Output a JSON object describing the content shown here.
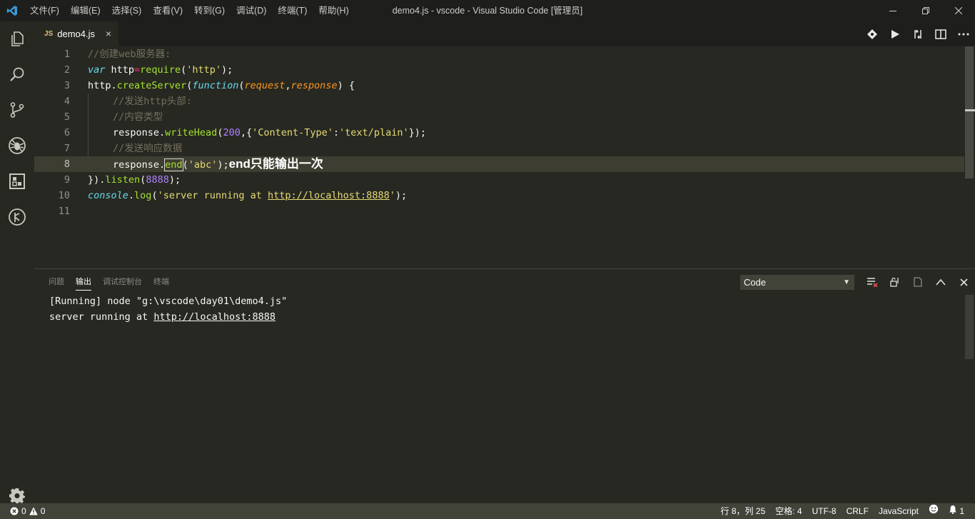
{
  "titlebar": {
    "logo_icon": "vscode-logo-icon",
    "menu": [
      "文件(F)",
      "编辑(E)",
      "选择(S)",
      "查看(V)",
      "转到(G)",
      "调试(D)",
      "终端(T)",
      "帮助(H)"
    ],
    "window_title": "demo4.js - vscode - Visual Studio Code [管理员]",
    "controls": [
      "minimize-icon",
      "restore-icon",
      "close-icon"
    ]
  },
  "activitybar": {
    "icons": [
      "explorer-icon",
      "search-icon",
      "source-control-icon",
      "debug-icon",
      "extensions-icon",
      "remote-icon"
    ],
    "bottom_icon": "settings-gear-icon"
  },
  "tabs": [
    {
      "badge": "JS",
      "label": "demo4.js",
      "close": "×"
    }
  ],
  "editor_actions": [
    "git-lens-icon",
    "run-icon",
    "compare-icon",
    "split-editor-icon",
    "more-icon"
  ],
  "editor": {
    "line_numbers": [
      "1",
      "2",
      "3",
      "4",
      "5",
      "6",
      "7",
      "8",
      "9",
      "10",
      "11"
    ],
    "current_line": 8,
    "code": {
      "l1_comment": "//创建web服务器:",
      "l2_var": "var",
      "l2_name": " http",
      "l2_eq": "=",
      "l2_require": "require",
      "l2_open": "(",
      "l2_str": "'http'",
      "l2_close": ");",
      "l3_obj": "http.",
      "l3_method": "createServer",
      "l3_open": "(",
      "l3_function": "function",
      "l3_paren": "(",
      "l3_p1": "request",
      "l3_comma": ",",
      "l3_p2": "response",
      "l3_end": ") {",
      "l4_comment": "//发送http头部:",
      "l5_comment": "//内容类型",
      "l6_obj": "response.",
      "l6_method": "writeHead",
      "l6_open": "(",
      "l6_num": "200",
      "l6_mid": ",{",
      "l6_key": "'Content-Type'",
      "l6_colon": ":",
      "l6_val": "'text/plain'",
      "l6_close": "});",
      "l7_comment": "//发送响应数据",
      "l8_obj": "response",
      "l8_dot": ".",
      "l8_method": "end",
      "l8_open": "(",
      "l8_str": "'abc'",
      "l8_close": ");",
      "l8_annotation": "end只能输出一次",
      "l9_start": "}).",
      "l9_method": "listen",
      "l9_open": "(",
      "l9_num": "8888",
      "l9_close": ");",
      "l10_obj": "console",
      "l10_dot": ".",
      "l10_method": "log",
      "l10_open": "(",
      "l10_str_a": "'server running at ",
      "l10_link": "http://localhost:8888",
      "l10_str_b": "'",
      "l10_close": ");"
    }
  },
  "panel": {
    "tabs": [
      "问题",
      "输出",
      "调试控制台",
      "终端"
    ],
    "active_tab": "输出",
    "channel_select": "Code",
    "actions": [
      "clear-output-icon",
      "lock-scroll-icon",
      "open-log-icon",
      "maximize-panel-icon",
      "close-panel-icon"
    ],
    "output_line1": "[Running] node \"g:\\vscode\\day01\\demo4.js\"",
    "output_line2_text": "server running at ",
    "output_line2_link": "http://localhost:8888"
  },
  "statusbar": {
    "errors": "0",
    "warnings": "0",
    "position": "行 8，列 25",
    "spaces": "空格: 4",
    "encoding": "UTF-8",
    "eol": "CRLF",
    "language": "JavaScript",
    "notifications": "1"
  }
}
